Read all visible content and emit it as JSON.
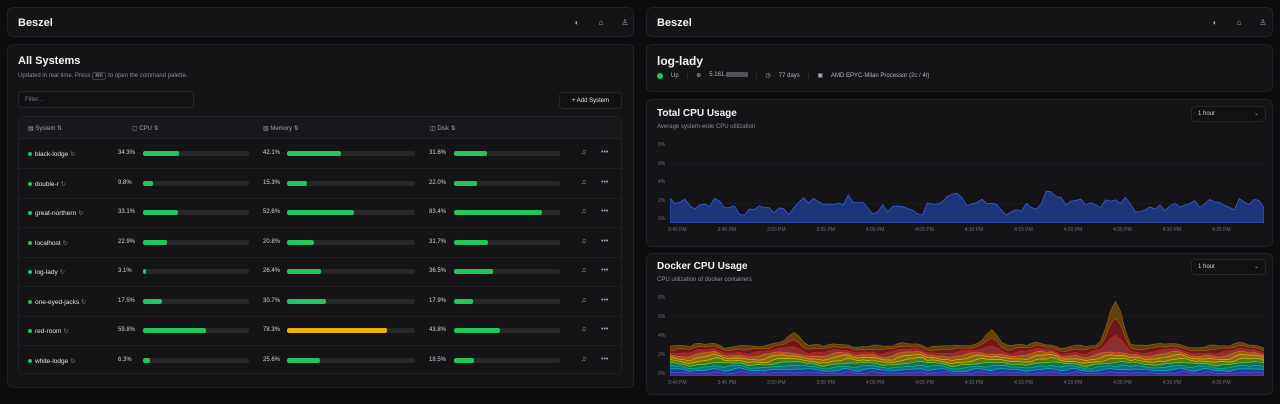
{
  "left": {
    "brand": "Beszel",
    "title": "All Systems",
    "subtitle_pre": "Updated in real time. Press",
    "kbd": "⌘K",
    "subtitle_post": "to open the command palette.",
    "filter_placeholder": "Filter...",
    "add_label": "+ Add System",
    "columns": {
      "system": "System",
      "cpu": "CPU",
      "memory": "Memory",
      "disk": "Disk"
    },
    "rows": [
      {
        "name": "black-lodge",
        "cpu": "34.3%",
        "cpu_v": 0.343,
        "mem": "42.1%",
        "mem_v": 0.421,
        "disk": "31.6%",
        "disk_v": 0.316,
        "mem_color": "#22c55e"
      },
      {
        "name": "double-r",
        "cpu": "9.8%",
        "cpu_v": 0.098,
        "mem": "15.3%",
        "mem_v": 0.153,
        "disk": "22.0%",
        "disk_v": 0.22,
        "mem_color": "#22c55e"
      },
      {
        "name": "great-northern",
        "cpu": "33.1%",
        "cpu_v": 0.331,
        "mem": "52.6%",
        "mem_v": 0.526,
        "disk": "83.4%",
        "disk_v": 0.834,
        "mem_color": "#22c55e"
      },
      {
        "name": "localhost",
        "cpu": "22.9%",
        "cpu_v": 0.229,
        "mem": "20.8%",
        "mem_v": 0.208,
        "disk": "31.7%",
        "disk_v": 0.317,
        "mem_color": "#22c55e"
      },
      {
        "name": "log-lady",
        "cpu": "3.1%",
        "cpu_v": 0.031,
        "mem": "26.4%",
        "mem_v": 0.264,
        "disk": "36.5%",
        "disk_v": 0.365,
        "mem_color": "#22c55e"
      },
      {
        "name": "one-eyed-jacks",
        "cpu": "17.5%",
        "cpu_v": 0.175,
        "mem": "30.7%",
        "mem_v": 0.307,
        "disk": "17.9%",
        "disk_v": 0.179,
        "mem_color": "#22c55e"
      },
      {
        "name": "red-room",
        "cpu": "59.8%",
        "cpu_v": 0.598,
        "mem": "78.3%",
        "mem_v": 0.783,
        "disk": "43.8%",
        "disk_v": 0.438,
        "mem_color": "#eab308"
      },
      {
        "name": "white-lodge",
        "cpu": "6.3%",
        "cpu_v": 0.063,
        "mem": "25.6%",
        "mem_v": 0.256,
        "disk": "18.5%",
        "disk_v": 0.185,
        "mem_color": "#22c55e"
      }
    ]
  },
  "right": {
    "brand": "Beszel",
    "system_name": "log-lady",
    "status": "Up",
    "ip": "5.161.",
    "uptime": "77 days",
    "cpu_model": "AMD EPYC-Milan Processor (2c / 4t)",
    "cpu_chart": {
      "title": "Total CPU Usage",
      "subtitle": "Average system-wide CPU utilization",
      "range": "1 hour",
      "y_ticks": [
        "8%",
        "6%",
        "4%",
        "2%",
        "0%"
      ],
      "x_ticks": [
        "3:40 PM",
        "3:45 PM",
        "3:50 PM",
        "3:55 PM",
        "4:00 PM",
        "4:05 PM",
        "4:10 PM",
        "4:15 PM",
        "4:20 PM",
        "4:25 PM",
        "4:30 PM",
        "4:35 PM"
      ]
    },
    "docker_chart": {
      "title": "Docker CPU Usage",
      "subtitle": "CPU utilization of docker containers",
      "range": "1 hour",
      "y_ticks": [
        "8%",
        "6%",
        "4%",
        "2%",
        "0%"
      ],
      "x_ticks": [
        "3:40 PM",
        "3:45 PM",
        "3:50 PM",
        "3:55 PM",
        "4:00 PM",
        "4:05 PM",
        "4:10 PM",
        "4:15 PM",
        "4:20 PM",
        "4:25 PM",
        "4:30 PM",
        "4:35 PM"
      ]
    }
  },
  "colors": {
    "green": "#22c55e",
    "yellow": "#eab308",
    "cpu_fill": "#1e3a8a"
  }
}
